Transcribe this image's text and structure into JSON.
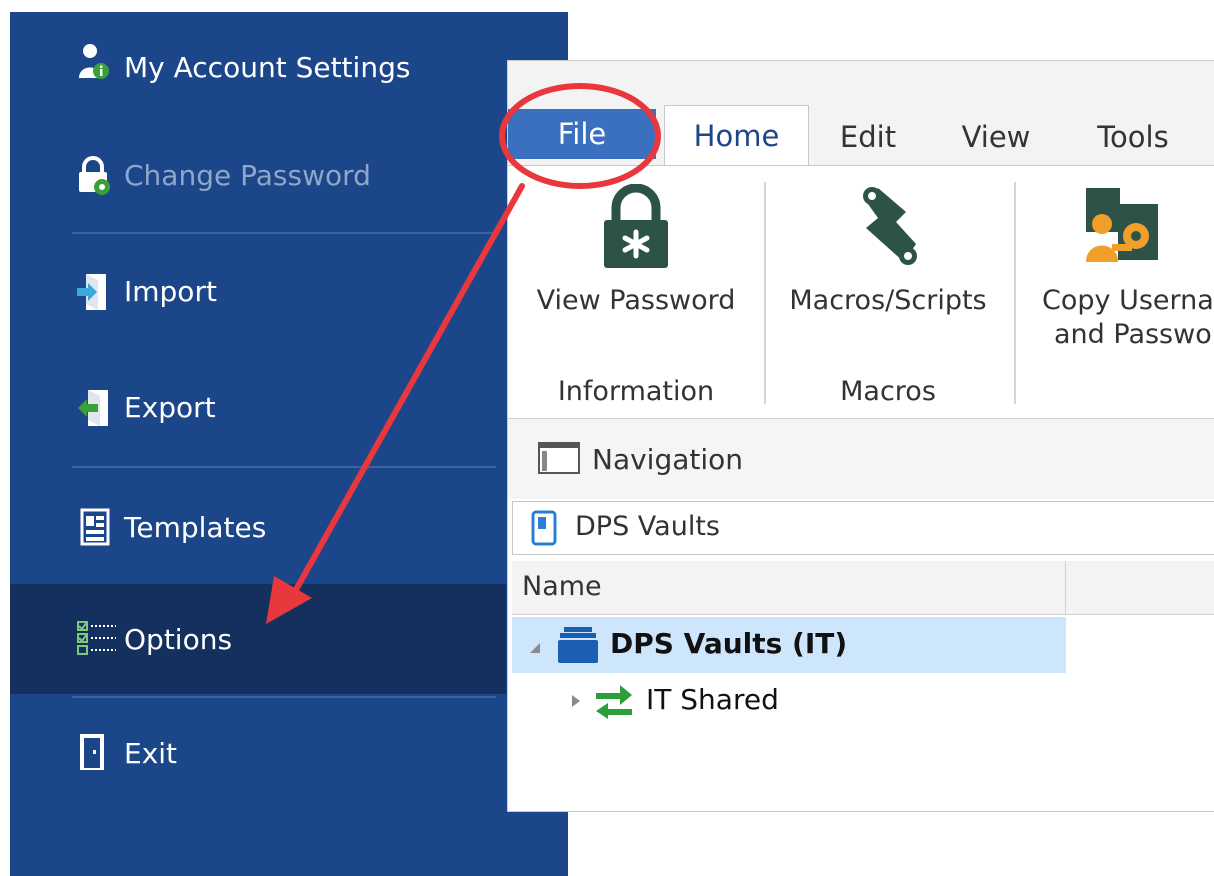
{
  "backstage": {
    "items": [
      {
        "label": "My Account Settings",
        "icon": "user-info-icon",
        "state": "normal"
      },
      {
        "label": "Change Password",
        "icon": "lock-gear-icon",
        "state": "disabled"
      },
      {
        "label": "Import",
        "icon": "import-icon",
        "state": "normal"
      },
      {
        "label": "Export",
        "icon": "export-icon",
        "state": "normal"
      },
      {
        "label": "Templates",
        "icon": "templates-icon",
        "state": "normal"
      },
      {
        "label": "Options",
        "icon": "options-checklist-icon",
        "state": "selected"
      },
      {
        "label": "Exit",
        "icon": "exit-door-icon",
        "state": "normal"
      }
    ]
  },
  "tabs": [
    {
      "label": "File",
      "state": "file"
    },
    {
      "label": "Home",
      "state": "active"
    },
    {
      "label": "Edit",
      "state": "normal"
    },
    {
      "label": "View",
      "state": "normal"
    },
    {
      "label": "Tools",
      "state": "normal"
    }
  ],
  "ribbon": {
    "buttons": [
      {
        "label": "View Password",
        "icon": "padlock-asterisk-icon"
      },
      {
        "label": "Macros/Scripts",
        "icon": "scroll-icon"
      },
      {
        "label_line1": "Copy Userna",
        "label_line2": "and Passwo",
        "icon": "copy-credentials-icon"
      }
    ],
    "groups": [
      {
        "label": "Information"
      },
      {
        "label": "Macros"
      }
    ]
  },
  "navigation": {
    "label": "Navigation",
    "icon": "navigation-pane-icon"
  },
  "breadcrumb": {
    "label": "DPS Vaults",
    "icon": "vault-phone-icon"
  },
  "grid": {
    "columns": [
      {
        "label": "Name"
      }
    ],
    "rows": [
      {
        "label": "DPS Vaults (IT)",
        "icon": "database-stack-icon",
        "expanded": true,
        "bold": true,
        "selected": true
      },
      {
        "label": "IT Shared",
        "icon": "sync-arrows-icon",
        "expanded": false,
        "bold": false,
        "selected": false
      }
    ]
  },
  "colors": {
    "backstage_bg": "#1b4689",
    "backstage_selected": "#14305e",
    "file_tab": "#3b6fc0",
    "annotation_red": "#e8383d",
    "tree_selected": "#cde6fb"
  }
}
